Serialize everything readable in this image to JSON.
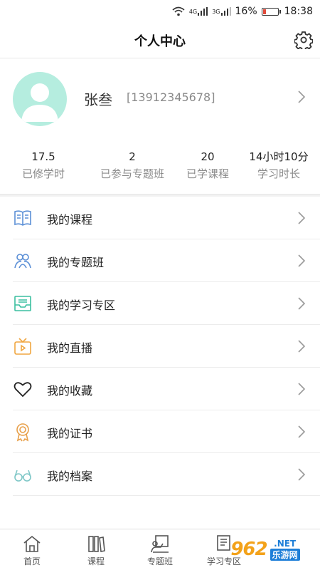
{
  "status_bar": {
    "network_1": "4G",
    "network_2": "3G",
    "battery": "16%",
    "time": "18:38",
    "battery_color": "#e24a3b"
  },
  "header": {
    "title": "个人中心",
    "settings_icon": "gear-icon"
  },
  "profile": {
    "name": "张叁",
    "phone": "[13912345678]",
    "avatar_color": "#b5eddf"
  },
  "stats": [
    {
      "value": "17.5",
      "label": "已修学时"
    },
    {
      "value": "2",
      "label": "已参与专题班"
    },
    {
      "value": "20",
      "label": "已学课程"
    },
    {
      "value": "14小时10分",
      "label": "学习时长"
    }
  ],
  "menu": [
    {
      "label": "我的课程",
      "icon": "book-icon",
      "color": "#5b8fd6"
    },
    {
      "label": "我的专题班",
      "icon": "group-icon",
      "color": "#5b8fd6"
    },
    {
      "label": "我的学习专区",
      "icon": "inbox-icon",
      "color": "#3bbfa0"
    },
    {
      "label": "我的直播",
      "icon": "tv-icon",
      "color": "#f0a640"
    },
    {
      "label": "我的收藏",
      "icon": "heart-icon",
      "color": "#222222"
    },
    {
      "label": "我的证书",
      "icon": "medal-icon",
      "color": "#e8a04a"
    },
    {
      "label": "我的档案",
      "icon": "glasses-icon",
      "color": "#7fc7c7"
    }
  ],
  "tabs": [
    {
      "label": "首页",
      "icon": "home-icon"
    },
    {
      "label": "课程",
      "icon": "books-icon"
    },
    {
      "label": "专题班",
      "icon": "board-icon"
    },
    {
      "label": "学习专区",
      "icon": "study-icon"
    }
  ],
  "watermark": {
    "logo": "962",
    "net": ".NET",
    "cn": "乐游网"
  }
}
